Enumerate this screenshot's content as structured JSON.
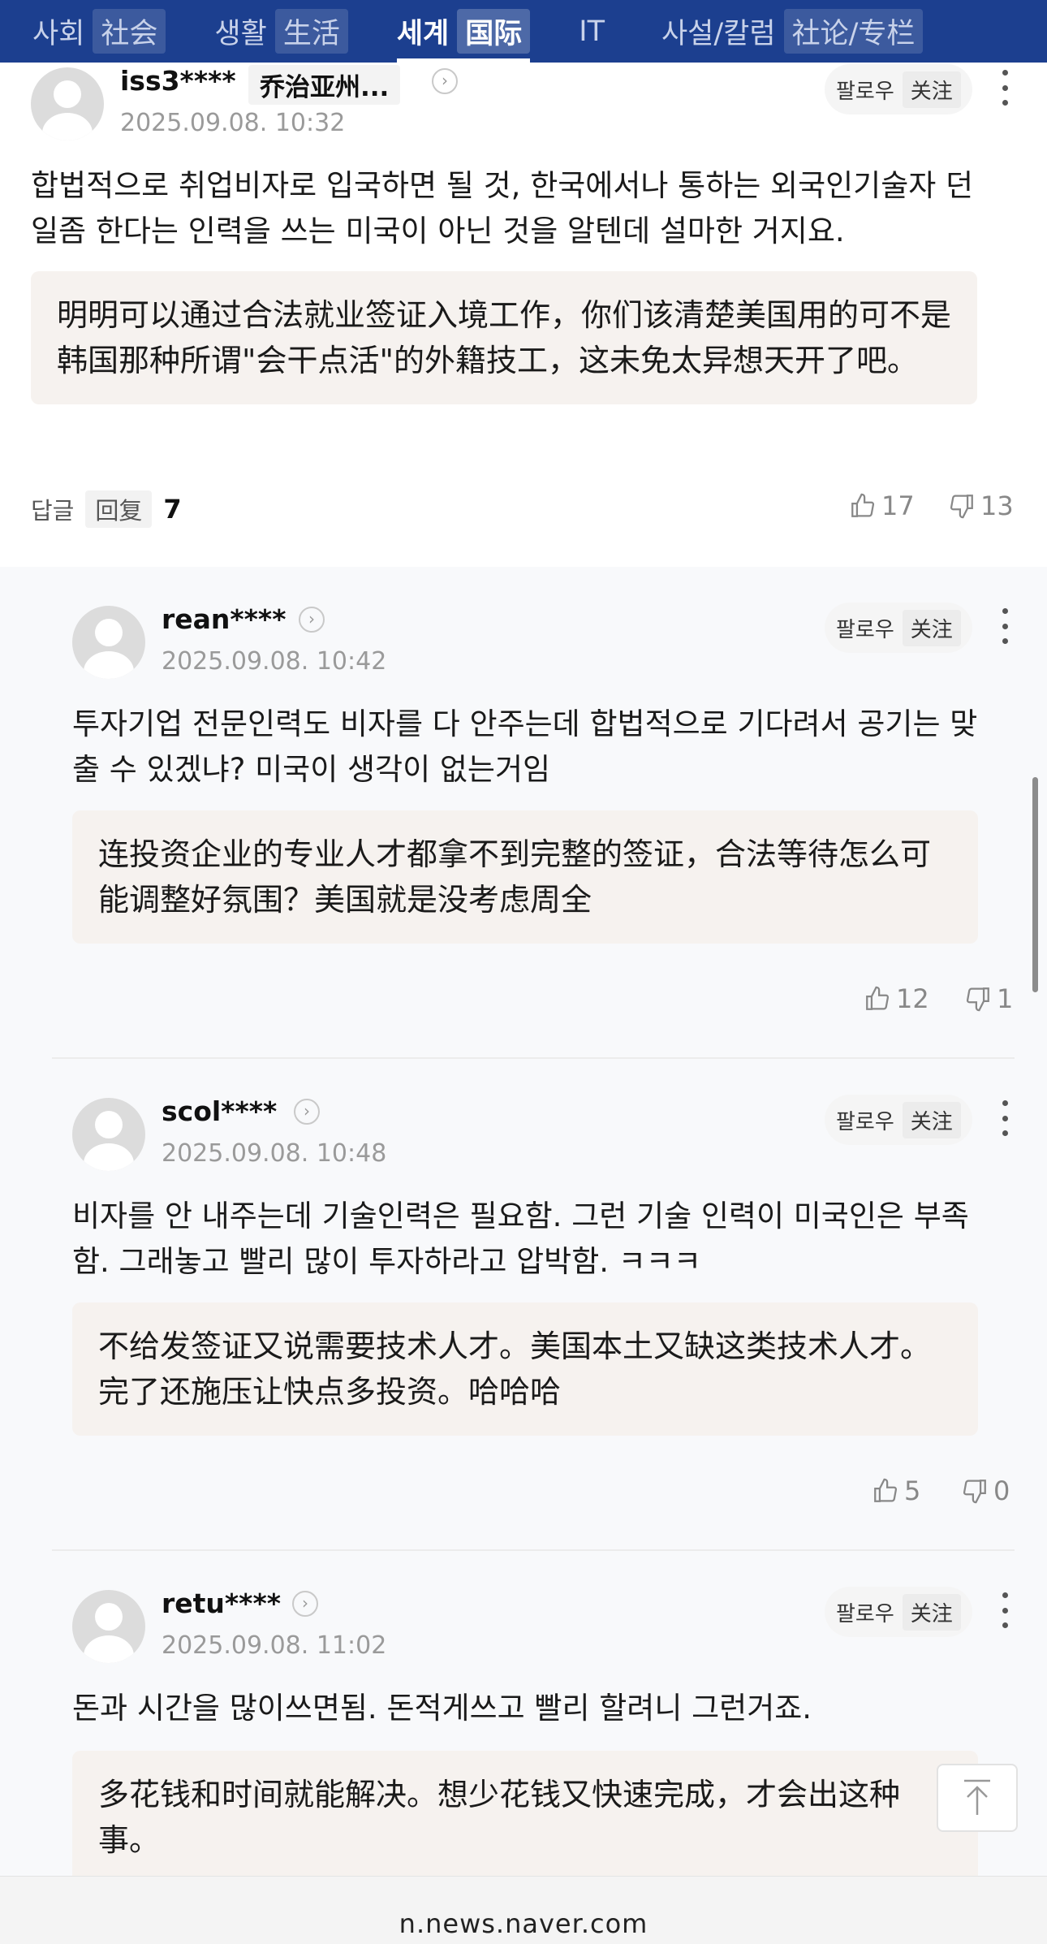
{
  "nav": {
    "items": [
      {
        "ko": "사회",
        "zh": "社会",
        "active": false
      },
      {
        "ko": "생활",
        "zh": "生活",
        "active": false
      },
      {
        "ko": "세계",
        "zh": "国际",
        "active": true
      },
      {
        "ko": "IT",
        "zh": "",
        "active": false
      },
      {
        "ko": "사설/칼럼",
        "zh": "社论/专栏",
        "active": false
      }
    ]
  },
  "follow": {
    "ko": "팔로우",
    "zh": "关注"
  },
  "comments": [
    {
      "username": "iss3****",
      "user_tag": "乔治亚州...",
      "timestamp": "2025.09.08. 10:32",
      "text_ko": "합법적으로 취업비자로 입국하면 될 것, 한국에서나 통하는 외국인기술자 던 일좀 한다는 인력을 쓰는 미국이 아닌 것을 알텐데 설마한 거지요.",
      "translation": "明明可以通过合法就业签证入境工作，你们该清楚美国用的可不是韩国那种所谓\"会干点活\"的外籍技工，这未免太异想天开了吧。",
      "reply_label_ko": "답글",
      "reply_label_zh": "回复",
      "reply_count": "7",
      "likes": "17",
      "dislikes": "13"
    },
    {
      "username": "rean****",
      "timestamp": "2025.09.08. 10:42",
      "text_ko": "투자기업 전문인력도 비자를 다 안주는데 합법적으로 기다려서 공기는 맞출 수 있겠냐? 미국이 생각이 없는거임",
      "translation": "连投资企业的专业人才都拿不到完整的签证，合法等待怎么可能调整好氛围？美国就是没考虑周全",
      "likes": "12",
      "dislikes": "1"
    },
    {
      "username": "scol****",
      "timestamp": "2025.09.08. 10:48",
      "text_ko": "비자를 안 내주는데 기술인력은 필요함. 그런 기술 인력이 미국인은 부족함. 그래놓고 빨리 많이 투자하라고 압박함. ㅋㅋㅋ",
      "translation": "不给发签证又说需要技术人才。美国本土又缺这类技术人才。完了还施压让快点多投资。哈哈哈",
      "likes": "5",
      "dislikes": "0"
    },
    {
      "username": "retu****",
      "timestamp": "2025.09.08. 11:02",
      "text_ko": "돈과 시간을 많이쓰면됨. 돈적게쓰고 빨리 할려니 그런거죠.",
      "translation": "多花钱和时间就能解决。想少花钱又快速完成，才会出这种事。"
    }
  ],
  "footer": {
    "domain": "n.news.naver.com"
  },
  "icons": {
    "chevron": "chevron-right-icon",
    "more": "more-vertical-icon",
    "like": "thumbs-up-icon",
    "dislike": "thumbs-down-icon",
    "back_to_top": "arrow-up-icon"
  }
}
